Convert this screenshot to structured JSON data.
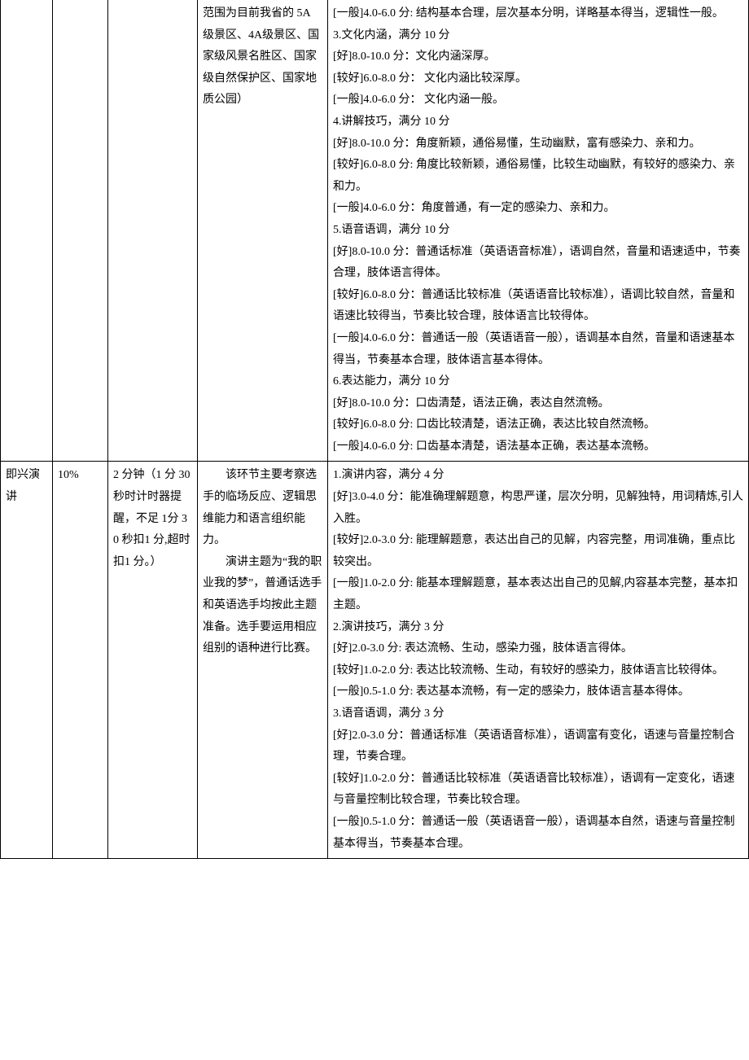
{
  "row1": {
    "c1": "",
    "c2": "",
    "c3": "",
    "c4": "范围为目前我省的 5A 级景区、4A级景区、国家级风景名胜区、国家级自然保护区、国家地质公园）",
    "c5_lines": [
      "[一般]4.0-6.0 分: 结构基本合理，层次基本分明，详略基本得当，逻辑性一般。",
      "3.文化内涵，满分 10 分",
      "[好]8.0-10.0 分：文化内涵深厚。",
      "[较好]6.0-8.0 分： 文化内涵比较深厚。",
      "[一般]4.0-6.0 分： 文化内涵一般。",
      "4.讲解技巧，满分 10 分",
      "[好]8.0-10.0 分：角度新颖，通俗易懂，生动幽默，富有感染力、亲和力。",
      "[较好]6.0-8.0 分: 角度比较新颖，通俗易懂，比较生动幽默，有较好的感染力、亲和力。",
      "[一般]4.0-6.0 分：角度普通，有一定的感染力、亲和力。",
      "5.语音语调，满分 10 分",
      "[好]8.0-10.0 分：普通话标准（英语语音标准），语调自然，音量和语速适中，节奏合理，肢体语言得体。",
      "[较好]6.0-8.0 分：普通话比较标准（英语语音比较标准），语调比较自然，音量和语速比较得当，节奏比较合理，肢体语言比较得体。",
      "[一般]4.0-6.0 分：普通话一般（英语语音一般），语调基本自然，音量和语速基本得当，节奏基本合理，肢体语言基本得体。",
      "6.表达能力，满分 10 分",
      "[好]8.0-10.0 分：口齿清楚，语法正确，表达自然流畅。",
      "[较好]6.0-8.0 分: 口齿比较清楚，语法正确，表达比较自然流畅。",
      "[一般]4.0-6.0 分: 口齿基本清楚，语法基本正确，表达基本流畅。"
    ]
  },
  "row2": {
    "c1": "即兴演讲",
    "c2": "10%",
    "c3": "2 分钟（1 分 30 秒时计时器提醒，不足 1分 30 秒扣1 分,超时扣1 分。）",
    "c4_p1": "该环节主要考察选手的临场反应、逻辑思维能力和语言组织能力。",
    "c4_p2": "演讲主题为“我的职业我的梦”，普通话选手和英语选手均按此主题准备。选手要运用相应组别的语种进行比赛。",
    "c5_lines": [
      "1.演讲内容，满分 4 分",
      "[好]3.0-4.0 分：能准确理解题意，构思严谨，层次分明，见解独特，用词精炼,引人入胜。",
      "[较好]2.0-3.0 分: 能理解题意，表达出自己的见解，内容完整，用词准确，重点比较突出。",
      "[一般]1.0-2.0 分: 能基本理解题意，基本表达出自己的见解,内容基本完整，基本扣主题。",
      "2.演讲技巧，满分 3 分",
      "[好]2.0-3.0 分: 表达流畅、生动，感染力强，肢体语言得体。",
      "[较好]1.0-2.0 分: 表达比较流畅、生动，有较好的感染力，肢体语言比较得体。",
      "[一般]0.5-1.0 分: 表达基本流畅，有一定的感染力，肢体语言基本得体。",
      "3.语音语调，满分 3 分",
      "[好]2.0-3.0 分：普通话标准（英语语音标准），语调富有变化，语速与音量控制合理，节奏合理。",
      "[较好]1.0-2.0 分：普通话比较标准（英语语音比较标准），语调有一定变化，语速与音量控制比较合理，节奏比较合理。",
      "[一般]0.5-1.0 分：普通话一般（英语语音一般），语调基本自然，语速与音量控制基本得当，节奏基本合理。"
    ]
  }
}
